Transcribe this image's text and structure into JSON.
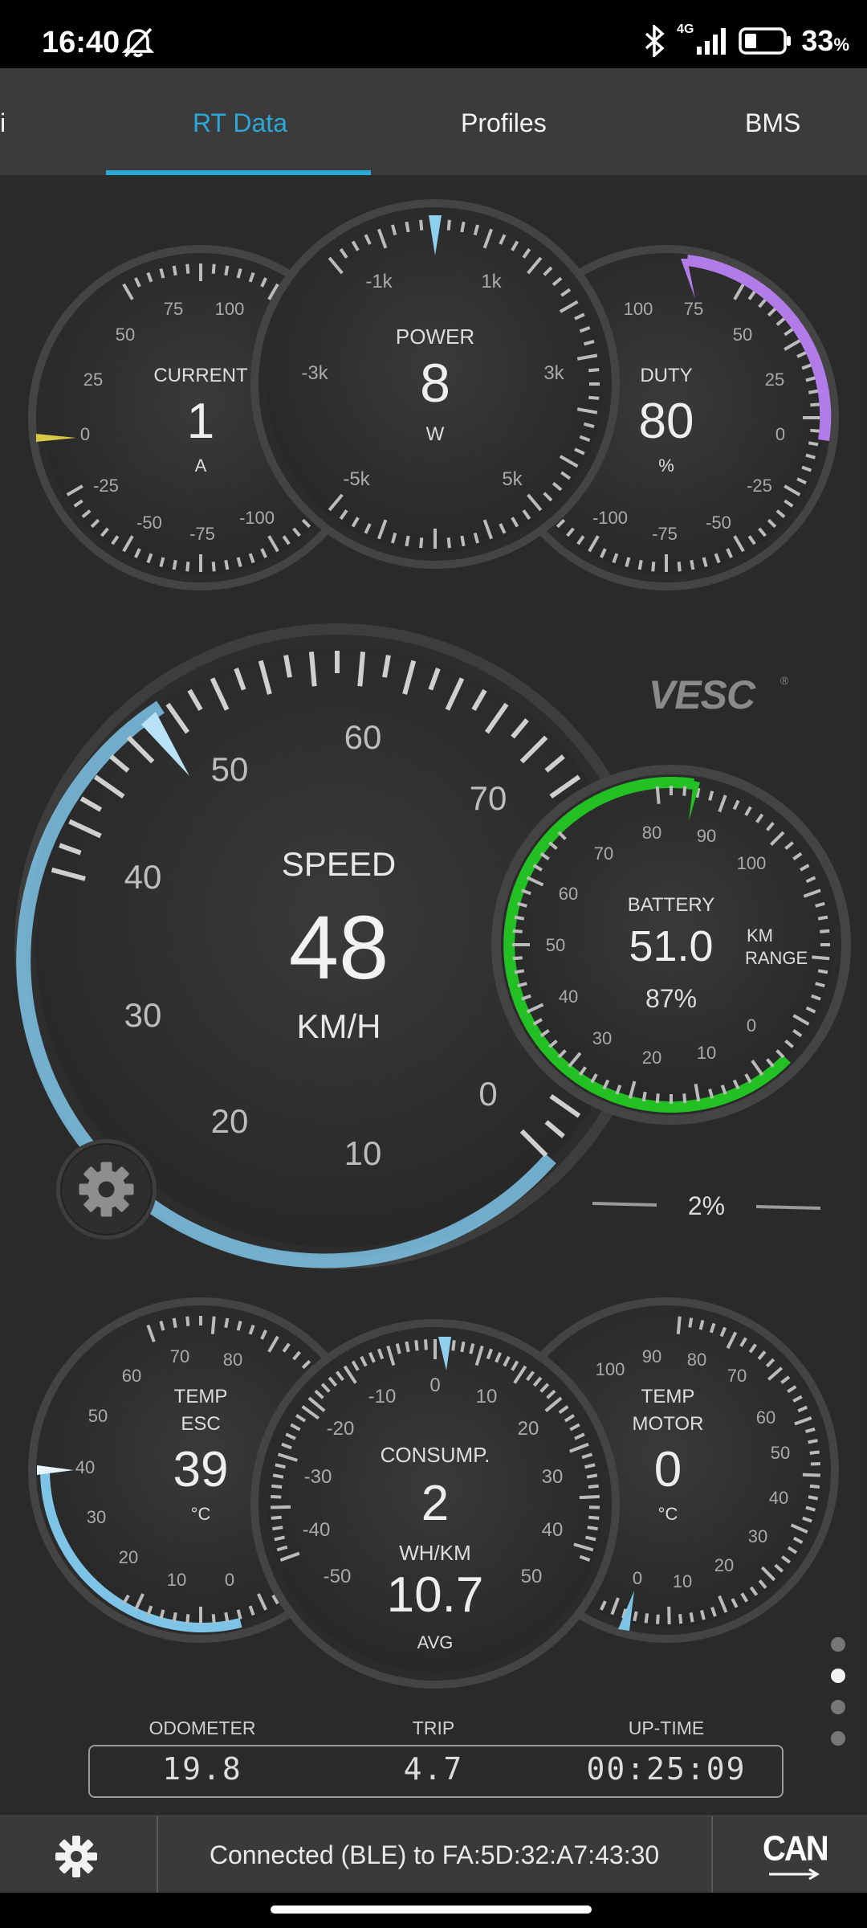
{
  "status_bar": {
    "time": "16:40",
    "network": "4G",
    "battery": "33",
    "battery_unit": "%"
  },
  "tabs": {
    "partial": "i",
    "rt_data": "RT Data",
    "profiles": "Profiles",
    "bms": "BMS"
  },
  "gauges": {
    "current": {
      "label": "CURRENT",
      "value": "1",
      "unit": "A",
      "ticks": [
        "75",
        "100",
        "50",
        "25",
        "0",
        "-25",
        "-50",
        "-75",
        "-100"
      ]
    },
    "power": {
      "label": "POWER",
      "value": "8",
      "unit": "W",
      "ticks": [
        "-1k",
        "1k",
        "-3k",
        "3k",
        "-5k",
        "5k"
      ]
    },
    "duty": {
      "label": "DUTY",
      "value": "80",
      "unit": "%",
      "ticks": [
        "100",
        "75",
        "50",
        "25",
        "0",
        "-25",
        "-50",
        "-75",
        "-100"
      ]
    },
    "speed": {
      "label": "SPEED",
      "value": "48",
      "unit": "KM/H",
      "ticks": [
        "60",
        "50",
        "70",
        "40",
        "30",
        "20",
        "10",
        "0"
      ]
    },
    "battery": {
      "label": "BATTERY",
      "value": "51.0",
      "unit_line1": "KM",
      "unit_line2": "RANGE",
      "percent": "87%",
      "ticks": [
        "80",
        "90",
        "70",
        "100",
        "60",
        "50",
        "40",
        "30",
        "20",
        "10",
        "0"
      ]
    },
    "temp_esc": {
      "label_line1": "TEMP",
      "label_line2": "ESC",
      "value": "39",
      "unit": "°C",
      "ticks": [
        "70",
        "80",
        "60",
        "50",
        "40",
        "30",
        "20",
        "10",
        "0"
      ]
    },
    "consumption": {
      "label": "CONSUMP.",
      "value": "2",
      "unit": "WH/KM",
      "avg_value": "10.7",
      "avg_label": "AVG",
      "ticks": [
        "0",
        "-10",
        "10",
        "-20",
        "20",
        "-30",
        "30",
        "-40",
        "40",
        "-50",
        "50"
      ]
    },
    "temp_motor": {
      "label_line1": "TEMP",
      "label_line2": "MOTOR",
      "value": "0",
      "unit": "°C",
      "ticks": [
        "100",
        "90",
        "80",
        "70",
        "60",
        "50",
        "40",
        "30",
        "20",
        "10",
        "0"
      ]
    }
  },
  "logo": "VESC",
  "throttle": {
    "percent": "2%"
  },
  "stats": {
    "odometer_label": "ODOMETER",
    "odometer": "19.8",
    "trip_label": "TRIP",
    "trip": "4.7",
    "uptime_label": "UP-TIME",
    "uptime": "00:25:09"
  },
  "bottom": {
    "status": "Connected (BLE) to FA:5D:32:A7:43:30",
    "can_label": "CAN"
  },
  "colors": {
    "accent": "#2aa8d8",
    "gauge_blue": "#8fd0ee",
    "battery_green": "#22c022",
    "duty_purple": "#b27ce8",
    "current_yellow": "#d8c84a"
  },
  "icons": [
    "bell-off-icon",
    "bluetooth-icon",
    "signal-icon",
    "battery-icon",
    "settings-gear-icon",
    "can-arrow-icon"
  ]
}
